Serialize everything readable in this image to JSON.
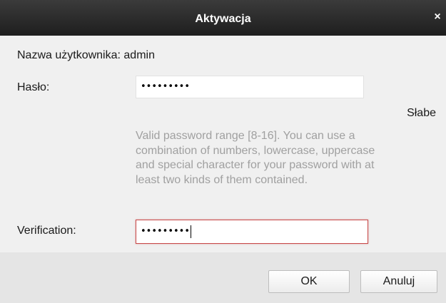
{
  "dialog": {
    "title": "Aktywacja",
    "close_glyph": "×"
  },
  "form": {
    "username_text": "Nazwa użytkownika: admin",
    "password_label": "Hasło:",
    "password_value": "•••••••••",
    "strength_text": "Słabe",
    "hint_text": "Valid password range [8-16]. You can use a combination of numbers, lowercase, uppercase and special character for your password with at least two kinds of them contained.",
    "verification_label": "Verification:",
    "verification_value": "•••••••••"
  },
  "buttons": {
    "ok_label": "OK",
    "cancel_label": "Anuluj"
  }
}
